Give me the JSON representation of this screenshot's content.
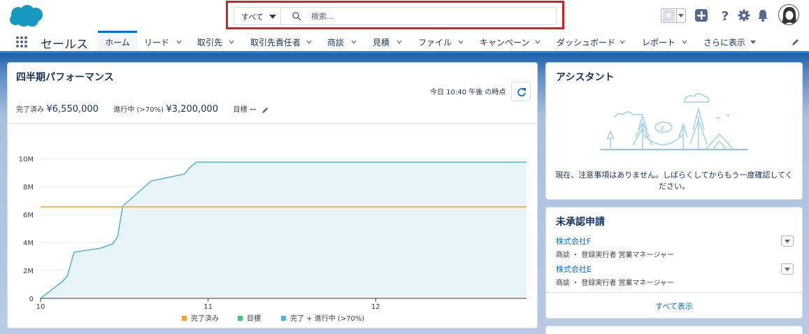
{
  "header": {
    "search_scope": "すべて",
    "search_placeholder": "検索...",
    "colors": {
      "highlight_border": "#d81f1f",
      "brand": "#1798c1"
    },
    "icons": [
      "salesforce-logo",
      "favorites-star-icon",
      "global-add-icon",
      "help-icon",
      "setup-gear-icon",
      "notifications-bell-icon",
      "user-avatar"
    ]
  },
  "nav": {
    "app_name": "セールス",
    "tabs": [
      {
        "label": "ホーム",
        "active": true,
        "chevron": false
      },
      {
        "label": "リード",
        "chevron": true
      },
      {
        "label": "取引先",
        "chevron": true
      },
      {
        "label": "取引先責任者",
        "chevron": true
      },
      {
        "label": "商談",
        "chevron": true
      },
      {
        "label": "見積",
        "chevron": true
      },
      {
        "label": "ファイル",
        "chevron": true
      },
      {
        "label": "キャンペーン",
        "chevron": true
      },
      {
        "label": "ダッシュボード",
        "chevron": true
      },
      {
        "label": "レポート",
        "chevron": true
      },
      {
        "label": "さらに表示",
        "chevron": false,
        "caret": true
      }
    ]
  },
  "performance": {
    "title": "四半期パフォーマンス",
    "as_of": "今日 10:40 午後 の時点",
    "closed_label": "完了済み",
    "closed_value": "¥6,550,000",
    "open_label": "進行中 (>70%)",
    "open_value": "¥3,200,000",
    "goal_label": "目標",
    "goal_value": "--"
  },
  "chart_data": {
    "type": "area",
    "x_ticks": [
      "10",
      "11",
      "12"
    ],
    "y_ticks": [
      "0",
      "2M",
      "4M",
      "6M",
      "8M",
      "10M"
    ],
    "ylim": [
      0,
      10
    ],
    "xlim": [
      10,
      12.9
    ],
    "series": [
      {
        "name": "完了 + 進行中 (>70%)",
        "color": "#54b3d0",
        "x": [
          10.0,
          10.13,
          10.16,
          10.2,
          10.36,
          10.43,
          10.46,
          10.49,
          10.66,
          10.86,
          10.89,
          10.93,
          12.9
        ],
        "values": [
          0,
          1.2,
          1.6,
          3.3,
          3.6,
          3.9,
          4.4,
          6.6,
          8.4,
          8.9,
          9.35,
          9.75,
          9.75
        ]
      },
      {
        "name": "完了済み",
        "color": "#f5a03c",
        "x": [
          10.0,
          12.9
        ],
        "values": [
          6.55,
          6.55
        ]
      }
    ],
    "legend": [
      {
        "name": "完了済み",
        "color": "#f5a03c"
      },
      {
        "name": "目標",
        "color": "#4bc076"
      },
      {
        "name": "完了 + 進行中 (>70%)",
        "color": "#54b3d0"
      }
    ],
    "legend_position": "bottom",
    "grid": true
  },
  "assistant": {
    "title": "アシスタント",
    "message": "現在、注意事項はありません。しばらくしてからもう一度確認してください。"
  },
  "approvals": {
    "title": "未承認申請",
    "items": [
      {
        "name": "株式会社F",
        "detail": "商談 ・ 登録実行者 営業マネージャー"
      },
      {
        "name": "株式会社E",
        "detail": "商談 ・ 登録実行者 営業マネージャー"
      }
    ],
    "view_all": "すべて表示"
  }
}
